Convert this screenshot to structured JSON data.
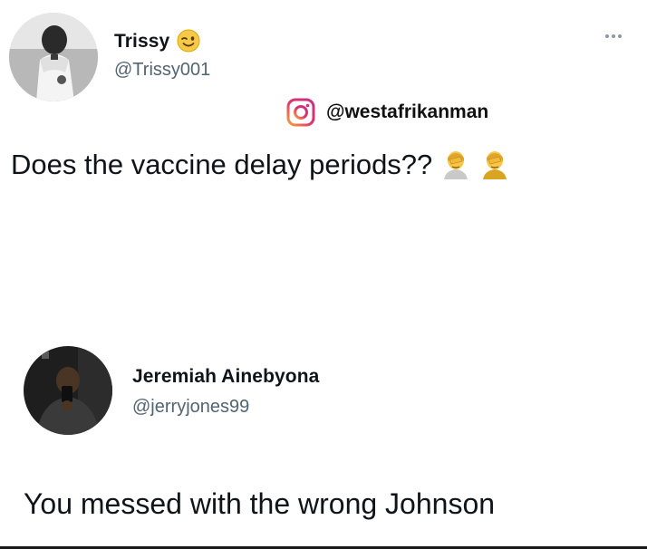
{
  "tweets": [
    {
      "name": "Trissy",
      "name_emoji": "winking-face-emoji",
      "handle": "@Trissy001",
      "text": "Does the vaccine delay periods??",
      "text_emoji": "person-facepalming-emoji"
    },
    {
      "name": "Jeremiah Ainebyona",
      "handle": "@jerryjones99",
      "text": "You messed with the wrong Johnson"
    }
  ],
  "watermark": {
    "icon": "instagram-icon",
    "handle": "@westafrikanman"
  },
  "icons": {
    "more": "more-options-icon"
  },
  "colors": {
    "text": "#0f1419",
    "secondary": "#536471",
    "instagram": "#e1306c"
  }
}
